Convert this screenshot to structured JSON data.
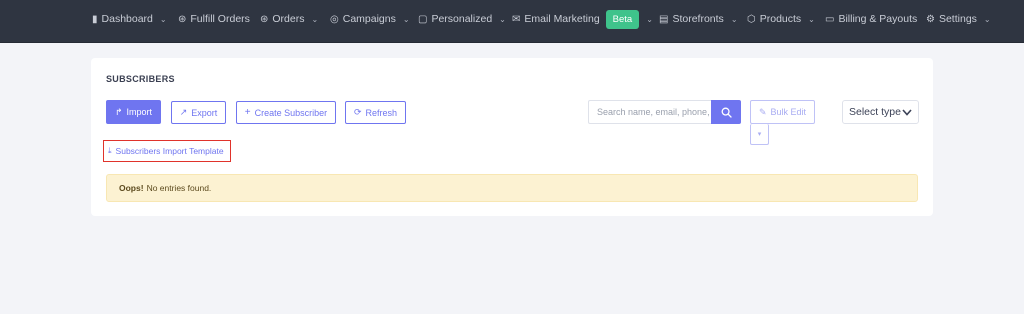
{
  "nav": {
    "items": [
      {
        "label": "Dashboard",
        "icon": "bar-chart-icon",
        "glyph": "❙",
        "dropdown": true
      },
      {
        "label": "Fulfill Orders",
        "icon": "cart-icon",
        "glyph": "⌸",
        "dropdown": false
      },
      {
        "label": "Orders",
        "icon": "cart-icon",
        "glyph": "⌸",
        "dropdown": true
      },
      {
        "label": "Campaigns",
        "icon": "target-icon",
        "glyph": "◎",
        "dropdown": true
      },
      {
        "label": "Personalized",
        "icon": "chat-icon",
        "glyph": "▢",
        "dropdown": true
      },
      {
        "label": "Email Marketing",
        "icon": "mail-icon",
        "glyph": "✉",
        "dropdown": true,
        "badge": "Beta"
      },
      {
        "label": "Storefronts",
        "icon": "store-icon",
        "glyph": "▤",
        "dropdown": true
      },
      {
        "label": "Products",
        "icon": "box-icon",
        "glyph": "⬡",
        "dropdown": true
      },
      {
        "label": "Billing & Payouts",
        "icon": "card-icon",
        "glyph": "▭",
        "dropdown": false
      },
      {
        "label": "Settings",
        "icon": "gear-icon",
        "glyph": "⚙",
        "dropdown": true
      }
    ]
  },
  "card": {
    "title": "SUBSCRIBERS",
    "import_label": "Import",
    "export_label": "Export",
    "create_label": "Create Subscriber",
    "refresh_label": "Refresh",
    "search_placeholder": "Search name, email, phone,",
    "bulk_edit_label": "Bulk Edit",
    "select_type_label": "Select type",
    "template_link_label": "Subscribers Import Template",
    "alert_strong": "Oops!",
    "alert_text": "No entries found."
  },
  "colors": {
    "accent": "#6f75f0",
    "nav_bg": "#2f3541",
    "beta_badge": "#3fc38b",
    "alert_bg": "#fcf2d2",
    "highlight_border": "#e0332b"
  }
}
